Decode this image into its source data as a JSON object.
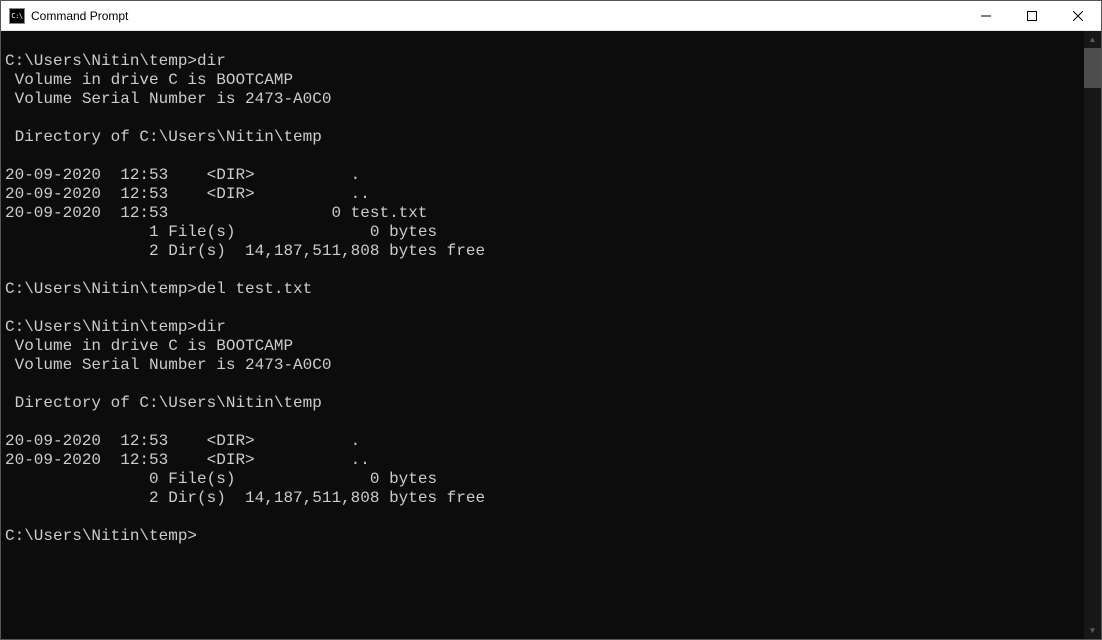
{
  "window": {
    "title": "Command Prompt",
    "icon_label": "C:\\"
  },
  "terminal": {
    "blocks": [
      {
        "prompt": "C:\\Users\\Nitin\\temp>",
        "command": "dir",
        "output": [
          " Volume in drive C is BOOTCAMP",
          " Volume Serial Number is 2473-A0C0",
          "",
          " Directory of C:\\Users\\Nitin\\temp",
          "",
          "20-09-2020  12:53    <DIR>          .",
          "20-09-2020  12:53    <DIR>          ..",
          "20-09-2020  12:53                 0 test.txt",
          "               1 File(s)              0 bytes",
          "               2 Dir(s)  14,187,511,808 bytes free",
          ""
        ]
      },
      {
        "prompt": "C:\\Users\\Nitin\\temp>",
        "command": "del test.txt",
        "output": [
          ""
        ]
      },
      {
        "prompt": "C:\\Users\\Nitin\\temp>",
        "command": "dir",
        "output": [
          " Volume in drive C is BOOTCAMP",
          " Volume Serial Number is 2473-A0C0",
          "",
          " Directory of C:\\Users\\Nitin\\temp",
          "",
          "20-09-2020  12:53    <DIR>          .",
          "20-09-2020  12:53    <DIR>          ..",
          "               0 File(s)              0 bytes",
          "               2 Dir(s)  14,187,511,808 bytes free",
          ""
        ]
      },
      {
        "prompt": "C:\\Users\\Nitin\\temp>",
        "command": "",
        "output": []
      }
    ]
  }
}
